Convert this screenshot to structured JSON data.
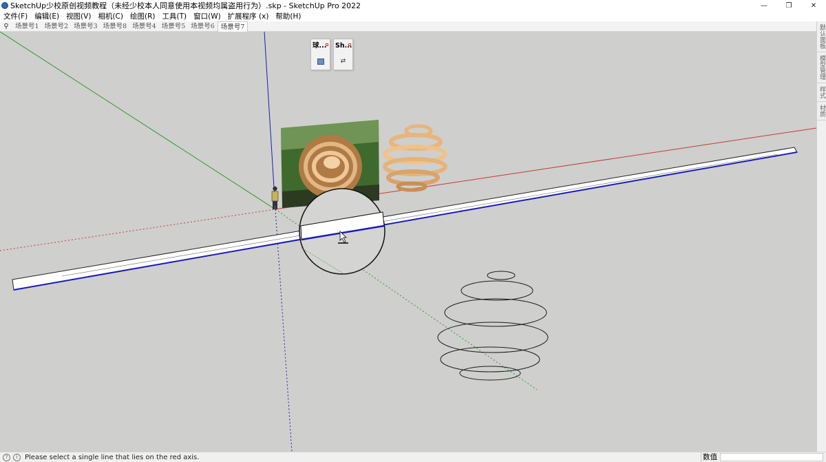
{
  "window": {
    "title": "SketchUp少校原创视频教程（未经少校本人同意使用本视频均属盗用行为）.skp - SketchUp Pro 2022",
    "controls": {
      "minimize": "—",
      "maximize": "❐",
      "close": "✕"
    }
  },
  "menu": {
    "items": [
      {
        "label": "文件(F)"
      },
      {
        "label": "编辑(E)"
      },
      {
        "label": "视图(V)"
      },
      {
        "label": "相机(C)"
      },
      {
        "label": "绘图(R)"
      },
      {
        "label": "工具(T)"
      },
      {
        "label": "窗口(W)"
      },
      {
        "label": "扩展程序 (x)"
      },
      {
        "label": "帮助(H)"
      }
    ]
  },
  "scenes": {
    "search_icon": "search-icon",
    "tabs": [
      {
        "label": "场景号1"
      },
      {
        "label": "场景号2"
      },
      {
        "label": "场景号3"
      },
      {
        "label": "场景号8"
      },
      {
        "label": "场景号4"
      },
      {
        "label": "场景号5"
      },
      {
        "label": "场景号6"
      },
      {
        "label": "场景号7",
        "active": true
      }
    ]
  },
  "floating_panels": [
    {
      "label": "球...",
      "icon": "square-icon"
    },
    {
      "label": "Sh...",
      "icon": "swap-icon"
    }
  ],
  "tray": {
    "tabs": [
      {
        "label": "默认面板"
      },
      {
        "label": "模型管理"
      },
      {
        "label": "样式"
      },
      {
        "label": "材质"
      }
    ]
  },
  "viewport": {
    "background": "#cfcfcd",
    "axis_colors": {
      "red": "#c23b3b",
      "green": "#2f9a2f",
      "blue": "#1a1ab8"
    }
  },
  "status": {
    "message": "Please select a single line that lies on the red axis.",
    "vcb_label": "数值",
    "vcb_value": ""
  }
}
